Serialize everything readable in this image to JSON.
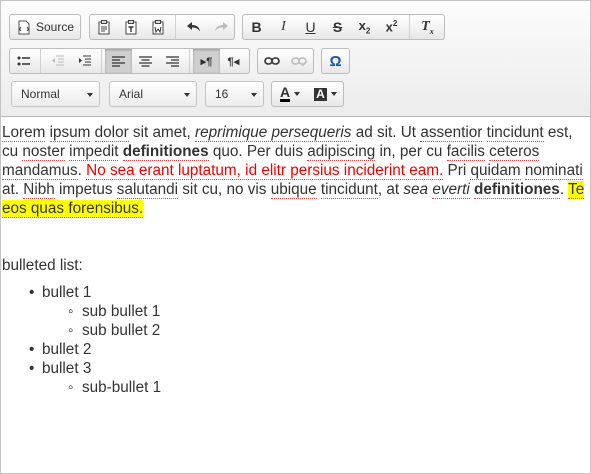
{
  "toolbar": {
    "source_label": "Source",
    "format_value": "Normal",
    "font_value": "Arial",
    "size_value": "16",
    "text_color_glyph": "A",
    "bg_color_glyph": "A"
  },
  "content": {
    "p1": {
      "s1": "Lorem",
      "s2": " ",
      "s3": "ipsum",
      "s4": " ",
      "s5": "dolor",
      "s6": " sit amet, ",
      "s7": "reprimique persequeris",
      "s8": " ad sit. Ut ",
      "s9": "assentior",
      "s10": " ",
      "s11": "tincidunt",
      "s12": " est, cu ",
      "s13": "noster",
      "s14": " ",
      "s15": "impedit",
      "s16": " ",
      "s17": "definitiones",
      "s18": " quo. Per duis ",
      "s19": "adipiscing",
      "s20": " in, per cu ",
      "s21": "facilis",
      "s22": " ",
      "s23": "ceteros",
      "s24": " ",
      "s25": "mandamus",
      "s26": ". ",
      "red_text": "No sea erant luptatum, id elitr persius inciderint eam.",
      "s27": " Pri ",
      "s28": "quidam",
      "s29": " ",
      "s30": "nominati",
      "s31": " at. ",
      "s32": "Nibh",
      "s33": " impetus ",
      "s34": "salutandi",
      "s35": " sit cu, no vis ",
      "s36": "ubique",
      "s37": " ",
      "s38": "tincidunt",
      "s39": ", at ",
      "s40": "sea",
      "s41": " ",
      "s42": "everti",
      "s43": " ",
      "s44": "definitiones",
      "s45": ". ",
      "highlight": "Te eos quas forensibus."
    },
    "list_heading": "bulleted list:",
    "bullets": [
      "bullet 1",
      "bullet 2",
      "bullet 3"
    ],
    "sub_bullets_1": [
      "sub bullet 1",
      "sub bullet 2"
    ],
    "sub_bullets_3": [
      "sub-bullet 1"
    ]
  },
  "colors": {
    "red_text": "#e00000",
    "highlight": "#ffff00",
    "special_char_icon": "#1a56b0"
  },
  "icons": [
    "source-icon",
    "paste-icon",
    "paste-text-icon",
    "paste-word-icon",
    "undo-icon",
    "redo-icon",
    "bold-icon",
    "italic-icon",
    "underline-icon",
    "strikethrough-icon",
    "subscript-icon",
    "superscript-icon",
    "remove-format-icon",
    "bulleted-list-icon",
    "outdent-icon",
    "indent-icon",
    "align-left-icon",
    "align-center-icon",
    "align-right-icon",
    "text-direction-ltr-icon",
    "text-direction-rtl-icon",
    "link-icon",
    "unlink-icon",
    "special-char-icon"
  ]
}
